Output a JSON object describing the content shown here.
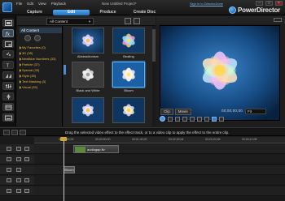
{
  "window": {
    "menu": [
      "File",
      "Edit",
      "View",
      "Playback"
    ],
    "doc_title": "New Untitled Project*",
    "sign_in": "Sign in to DirectorZone",
    "brand": "PowerDirector",
    "modes": [
      {
        "label": "Capture",
        "active": false
      },
      {
        "label": "Edit",
        "active": true
      },
      {
        "label": "Produce",
        "active": false
      },
      {
        "label": "Create Disc",
        "active": false
      }
    ]
  },
  "library": {
    "filter_selected": "All Content",
    "categories": [
      {
        "label": "All Content"
      },
      {
        "label": "My Favorites  (0)"
      },
      {
        "label": "3D  (35)"
      },
      {
        "label": "NewBlue Numbers  (33)"
      },
      {
        "label": "Particle  (37)"
      },
      {
        "label": "Special  (33)"
      },
      {
        "label": "Style  (39)"
      },
      {
        "label": "Text Masking  (3)"
      },
      {
        "label": "Visual  (39)"
      }
    ],
    "effects": [
      {
        "label": "Abstractionism"
      },
      {
        "label": "Beating"
      },
      {
        "label": "Black and White"
      },
      {
        "label": "Bloom"
      },
      {
        "label": ""
      },
      {
        "label": ""
      }
    ],
    "selected_effect": "Bloom"
  },
  "preview": {
    "clip_label": "Clip",
    "movie_label": "Movie",
    "timecode": "00;00;00;00",
    "fit": "Fit"
  },
  "status_text": "Drag the selected video effect to the effect track, or to a video clip to apply the effect to the entire clip.",
  "timeline": {
    "ruler_marks": [
      "00;00;00;00",
      "00;00;50;00",
      "00;01;40;02",
      "00;02;30;04",
      "00;03;20;06",
      "00;04;10;08"
    ],
    "video_clip_label": "audiogap.flv",
    "fx_clip_label": "Bloom"
  },
  "icons": {
    "app": "app-icon",
    "brand": "powerdirector-logo-icon"
  },
  "colors": {
    "accent": "#3d8fdc",
    "category_text": "#e9b54a",
    "preview_bg": "#0b2848"
  }
}
